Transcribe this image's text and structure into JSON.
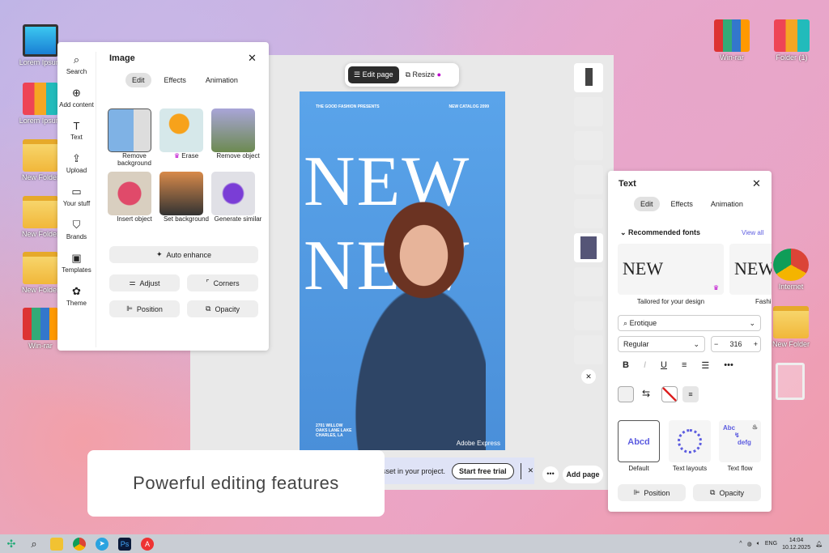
{
  "desktop": {
    "left_icons": [
      "Lorem Ipsum",
      "Lorem Ipsum",
      "New Folder",
      "New Folder",
      "New Folder",
      "Win-rar"
    ],
    "right_icons": [
      "Win-rar",
      "Folder (1)",
      "Internet",
      "New Folder"
    ]
  },
  "toolbar": {
    "edit_page": "Edit page",
    "resize": "Resize"
  },
  "rail": [
    "Search",
    "Add content",
    "Text",
    "Upload",
    "Your stuff",
    "Brands",
    "Templates",
    "Theme"
  ],
  "image_panel": {
    "title": "Image",
    "tabs": [
      "Edit",
      "Effects",
      "Animation"
    ],
    "tools": [
      "Remove background",
      "Erase",
      "Remove object",
      "Insert object",
      "Set background",
      "Generate similar"
    ],
    "auto_enhance": "Auto enhance",
    "adjust": "Adjust",
    "corners": "Corners",
    "position": "Position",
    "opacity": "Opacity"
  },
  "poster": {
    "top_left": "THE GOOD FASHION PRESENTS",
    "top_right": "NEW CATALOG 2099",
    "headline": "NEW",
    "bottom_left": "2701 WILLOW\nOAKS LANE LAKE\nCHARLES, LA",
    "brand": "Adobe Express"
  },
  "banner": {
    "text": "sset in your project.",
    "trial": "Start free trial"
  },
  "add_page": "Add page",
  "caption": "Powerful editing features",
  "text_panel": {
    "title": "Text",
    "tabs": [
      "Edit",
      "Effects",
      "Animation"
    ],
    "recommended": "Recommended fonts",
    "view_all": "View all",
    "font_preview": "NEW",
    "font_cards": [
      "Tailored for your design",
      "Fashion"
    ],
    "font": "Erotique",
    "weight": "Regular",
    "size": "316",
    "layouts": [
      "Default",
      "Text layouts",
      "Text flow"
    ],
    "default_sample": "Abcd",
    "flow_a": "Abc",
    "flow_b": "defg",
    "position": "Position",
    "opacity": "Opacity"
  },
  "taskbar": {
    "lang": "ENG",
    "time": "14:04",
    "date": "10.12.2025"
  },
  "colors": {
    "accent": "#5c5ce0",
    "poster": "#4a98e6"
  }
}
